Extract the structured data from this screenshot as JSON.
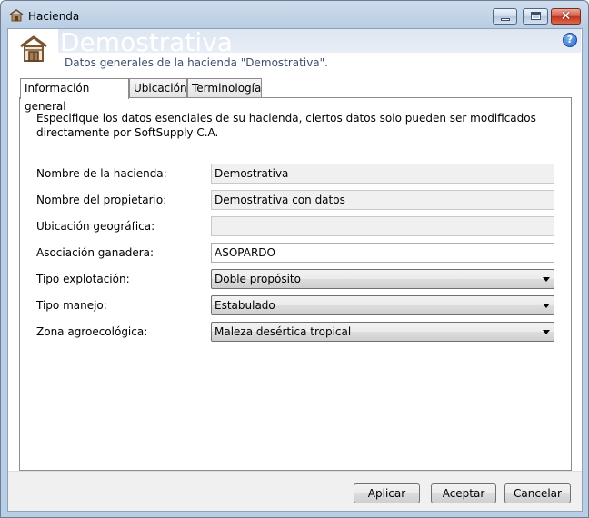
{
  "window": {
    "title": "Hacienda",
    "minimize_glyph": "",
    "close_glyph": "✕"
  },
  "header": {
    "title": "Demostrativa",
    "subtitle": "Datos generales de la hacienda \"Demostrativa\".",
    "icon": "farmhouse-icon",
    "help_glyph": "?"
  },
  "tabs": [
    {
      "label": "Información general",
      "active": true
    },
    {
      "label": "Ubicación",
      "active": false
    },
    {
      "label": "Terminología",
      "active": false
    }
  ],
  "form": {
    "intro": "Especifique los datos esenciales de su hacienda, ciertos datos solo pueden ser modificados directamente por SoftSupply C.A.",
    "fields": [
      {
        "label": "Nombre de la hacienda:",
        "value": "Demostrativa",
        "type": "readonly"
      },
      {
        "label": "Nombre del propietario:",
        "value": "Demostrativa con datos",
        "type": "readonly"
      },
      {
        "label": "Ubicación geográfica:",
        "value": "",
        "type": "readonly"
      },
      {
        "label": "Asociación ganadera:",
        "value": "ASOPARDO",
        "type": "text"
      },
      {
        "label": "Tipo explotación:",
        "value": "Doble propósito",
        "type": "select"
      },
      {
        "label": "Tipo manejo:",
        "value": "Estabulado",
        "type": "select"
      },
      {
        "label": "Zona agroecológica:",
        "value": "Maleza desértica tropical",
        "type": "select"
      }
    ]
  },
  "footer": {
    "apply_label": "Aplicar",
    "ok_label": "Aceptar",
    "cancel_label": "Cancelar"
  },
  "colors": {
    "frame": "#b9cde4",
    "subtitle": "#3c4f6b",
    "help": "#2a65c4",
    "close": "#c2331c"
  }
}
